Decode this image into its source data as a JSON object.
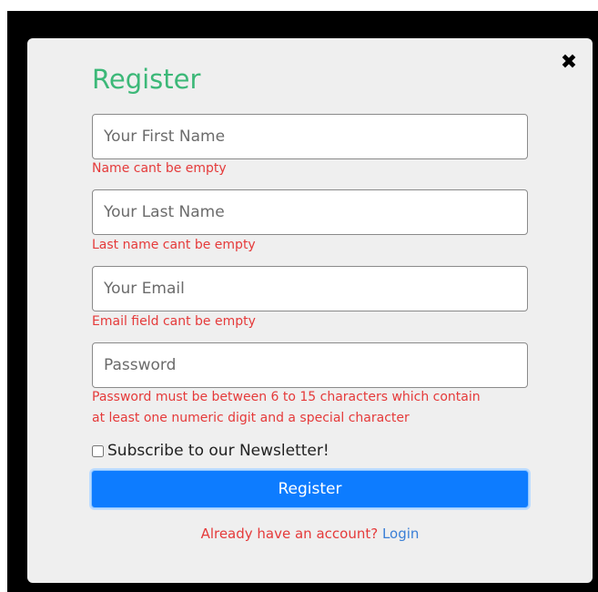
{
  "modal": {
    "title": "Register",
    "close_icon": "close-icon"
  },
  "form": {
    "first_name": {
      "placeholder": "Your First Name",
      "value": "",
      "error": "Name cant be empty"
    },
    "last_name": {
      "placeholder": "Your Last Name",
      "value": "",
      "error": "Last name cant be empty"
    },
    "email": {
      "placeholder": "Your Email",
      "value": "",
      "error": "Email field cant be empty"
    },
    "password": {
      "placeholder": "Password",
      "value": "",
      "error_line1": "Password must be between 6 to 15 characters which contain",
      "error_line2": "at least one numeric digit and a special character"
    },
    "newsletter": {
      "label": "Subscribe to our Newsletter!",
      "checked": false
    },
    "submit_label": "Register"
  },
  "footer": {
    "question": "Already have an account?",
    "login_label": "Login"
  },
  "colors": {
    "title": "#3cb878",
    "error": "#e53a3a",
    "button": "#0d7cff",
    "link": "#3a7fd6",
    "modal_bg": "#efefef",
    "backdrop": "#000000"
  }
}
